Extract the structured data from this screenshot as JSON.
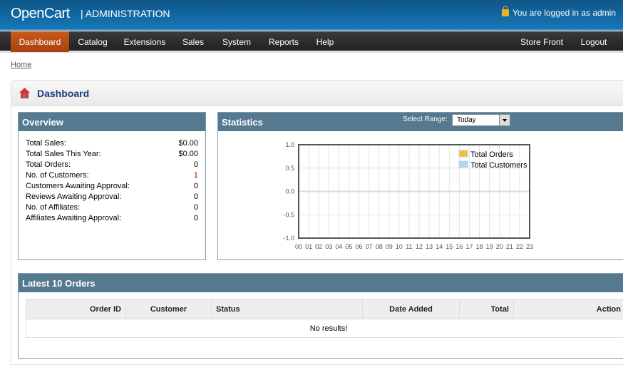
{
  "header": {
    "logo": "OpenCart",
    "subtitle": "| ADMINISTRATION",
    "login_text": "You are logged in as admin"
  },
  "nav": {
    "left": [
      "Dashboard",
      "Catalog",
      "Extensions",
      "Sales",
      "System",
      "Reports",
      "Help"
    ],
    "right": [
      "Store Front",
      "Logout"
    ],
    "active": "Dashboard"
  },
  "breadcrumb": "Home",
  "page_title": "Dashboard",
  "overview": {
    "title": "Overview",
    "rows": [
      {
        "label": "Total Sales:",
        "value": "$0.00"
      },
      {
        "label": "Total Sales This Year:",
        "value": "$0.00"
      },
      {
        "label": "Total Orders:",
        "value": "0"
      },
      {
        "label": "No. of Customers:",
        "value": "1"
      },
      {
        "label": "Customers Awaiting Approval:",
        "value": "0"
      },
      {
        "label": "Reviews Awaiting Approval:",
        "value": "0"
      },
      {
        "label": "No. of Affiliates:",
        "value": "0"
      },
      {
        "label": "Affiliates Awaiting Approval:",
        "value": "0"
      }
    ]
  },
  "statistics": {
    "title": "Statistics",
    "range_label": "Select Range:",
    "range_value": "Today"
  },
  "chart_data": {
    "type": "line",
    "x": [
      "00",
      "01",
      "02",
      "03",
      "04",
      "05",
      "06",
      "07",
      "08",
      "09",
      "10",
      "11",
      "12",
      "13",
      "14",
      "15",
      "16",
      "17",
      "18",
      "19",
      "20",
      "21",
      "22",
      "23"
    ],
    "series": [
      {
        "name": "Total Orders",
        "color": "#edc240",
        "values": [
          0,
          0,
          0,
          0,
          0,
          0,
          0,
          0,
          0,
          0,
          0,
          0,
          0,
          0,
          0,
          0,
          0,
          0,
          0,
          0,
          0,
          0,
          0,
          0
        ]
      },
      {
        "name": "Total Customers",
        "color": "#afd8f8",
        "values": [
          0,
          0,
          0,
          0,
          0,
          0,
          0,
          0,
          0,
          0,
          0,
          0,
          0,
          0,
          0,
          0,
          0,
          0,
          0,
          0,
          0,
          0,
          0,
          0
        ]
      }
    ],
    "yticks": [
      "1.0",
      "0.5",
      "0.0",
      "-0.5",
      "-1.0"
    ],
    "ylim": [
      -1,
      1
    ],
    "grid": true,
    "legend": "top-right"
  },
  "orders": {
    "title": "Latest 10 Orders",
    "columns": [
      "Order ID",
      "Customer",
      "Status",
      "Date Added",
      "Total",
      "Action"
    ],
    "empty": "No results!"
  },
  "colors": {
    "header": "#1677b8",
    "nav_active": "#c0501a",
    "panel_header": "#55798f"
  }
}
